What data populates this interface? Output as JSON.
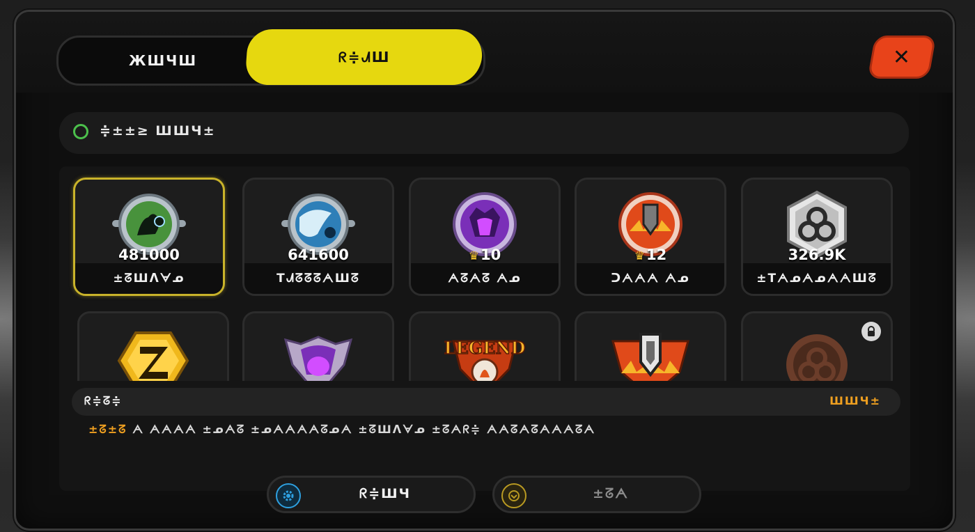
{
  "tabs": [
    {
      "label": "ЖШЧШ"
    },
    {
      "label": "ᖇ≑ᗂШ",
      "active": true
    }
  ],
  "close_label": "✕",
  "filter": {
    "label": "≑±±≥ ШШЧ±"
  },
  "cards": [
    {
      "value": "481000",
      "name": "±ᘔШᐱᗄᓄ",
      "badge": "green-astronaut-badge",
      "selected": true
    },
    {
      "value": "641600",
      "name": "ТᗂᘔᘔᘔᗅШᘔ",
      "badge": "blue-planet-badge"
    },
    {
      "value": "10",
      "crown": true,
      "name": "ᗅᘔᗅᘔ ᗅᓄ",
      "badge": "purple-skull-badge"
    },
    {
      "value": "12",
      "crown": true,
      "name": "ᑐᗅᗅᗅ ᗅᓄ",
      "badge": "orange-shield-badge"
    },
    {
      "value": "326.9K",
      "name": "±ТᗅᓄᗅᓄᗅᗅШᘔ",
      "badge": "silver-knot-badge"
    },
    {
      "value": "",
      "name": "",
      "badge": "gold-z-badge"
    },
    {
      "value": "",
      "name": "",
      "badge": "purple-skull-crest-badge"
    },
    {
      "value": "",
      "name": "",
      "badge": "legend-crest-badge",
      "text": "LEGEND"
    },
    {
      "value": "",
      "name": "",
      "badge": "shield-crest-badge"
    },
    {
      "value": "",
      "name": "",
      "badge": "bronze-knot-badge",
      "locked": true
    }
  ],
  "info": {
    "left": "ᖇ≑ᘔ≑",
    "right": "ШШЧ±"
  },
  "description": {
    "highlight": "±ᘔ±ᘔ",
    "text": " ᗅ ᗅᗅᗅᗅ ±ᓄᗅᘔ ±ᓄᗅᗅᗅᗅᘔᓄᗅ ±ᘔШᐱᗄᓄ   ±ᘔᗅᖇ≑ ᗅᗅᘔᗅᘔᗅᗅᗅᘔᗅ"
  },
  "buttons": [
    {
      "label": "ᖇ≑ШЧ",
      "icon": "gear-icon"
    },
    {
      "label": "±ᘔᗅ",
      "icon": "coin-icon"
    }
  ],
  "colors": {
    "accent": "#e6d80f",
    "close": "#e8431a",
    "selected_border": "#c9b32a",
    "highlight": "#f0a020"
  }
}
